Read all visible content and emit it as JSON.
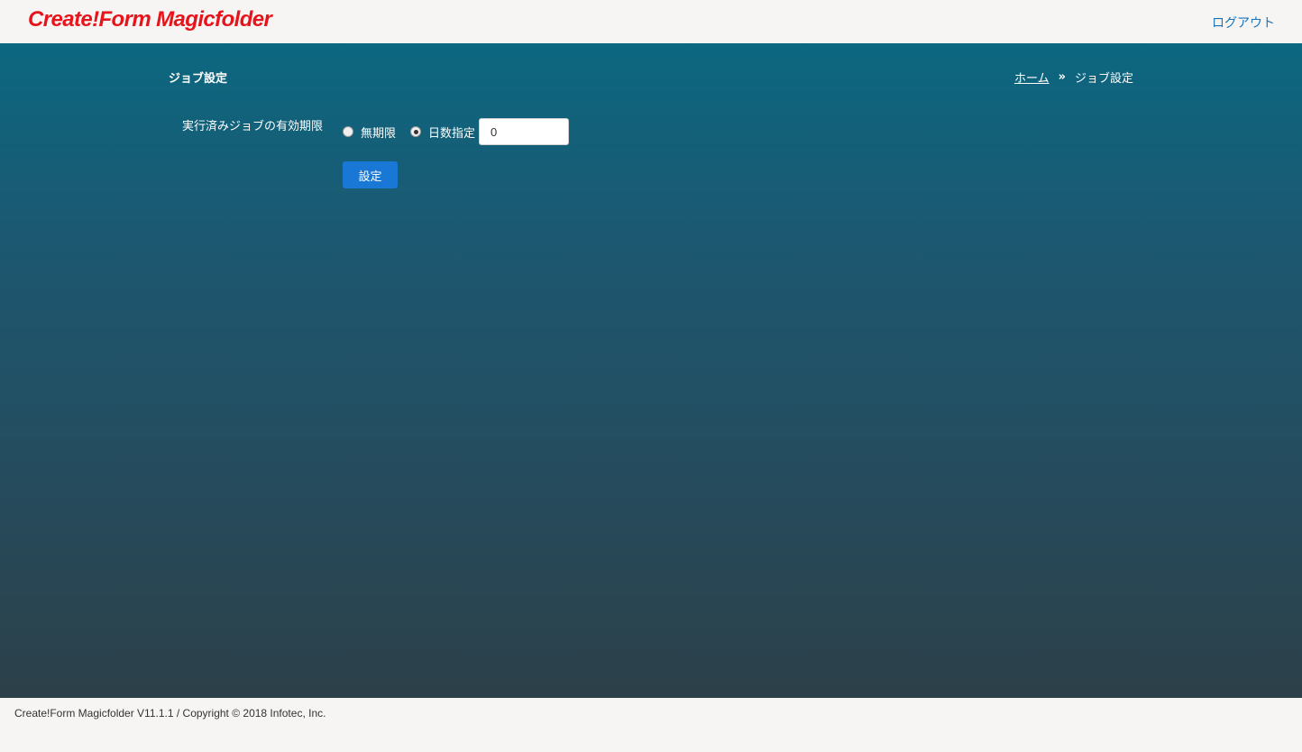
{
  "header": {
    "logo_text": "Create!Form Magicfolder",
    "logout_label": "ログアウト"
  },
  "page": {
    "title": "ジョブ設定",
    "breadcrumb": {
      "home": "ホーム",
      "separator": "»",
      "current": "ジョブ設定"
    }
  },
  "form": {
    "expiry_label": "実行済みジョブの有効期限",
    "options": [
      {
        "label": "無期限",
        "checked": false
      },
      {
        "label": "日数指定",
        "checked": true
      }
    ],
    "days_value": "0",
    "submit_label": "設定"
  },
  "footer": {
    "copyright": "Create!Form Magicfolder V11.1.1 / Copyright © 2018 Infotec, Inc."
  },
  "colors": {
    "logo": "#e8141c",
    "link": "#1a73b8",
    "button": "#1978d6",
    "gradient_top": "#0c6780",
    "gradient_bottom": "#2c4049"
  }
}
